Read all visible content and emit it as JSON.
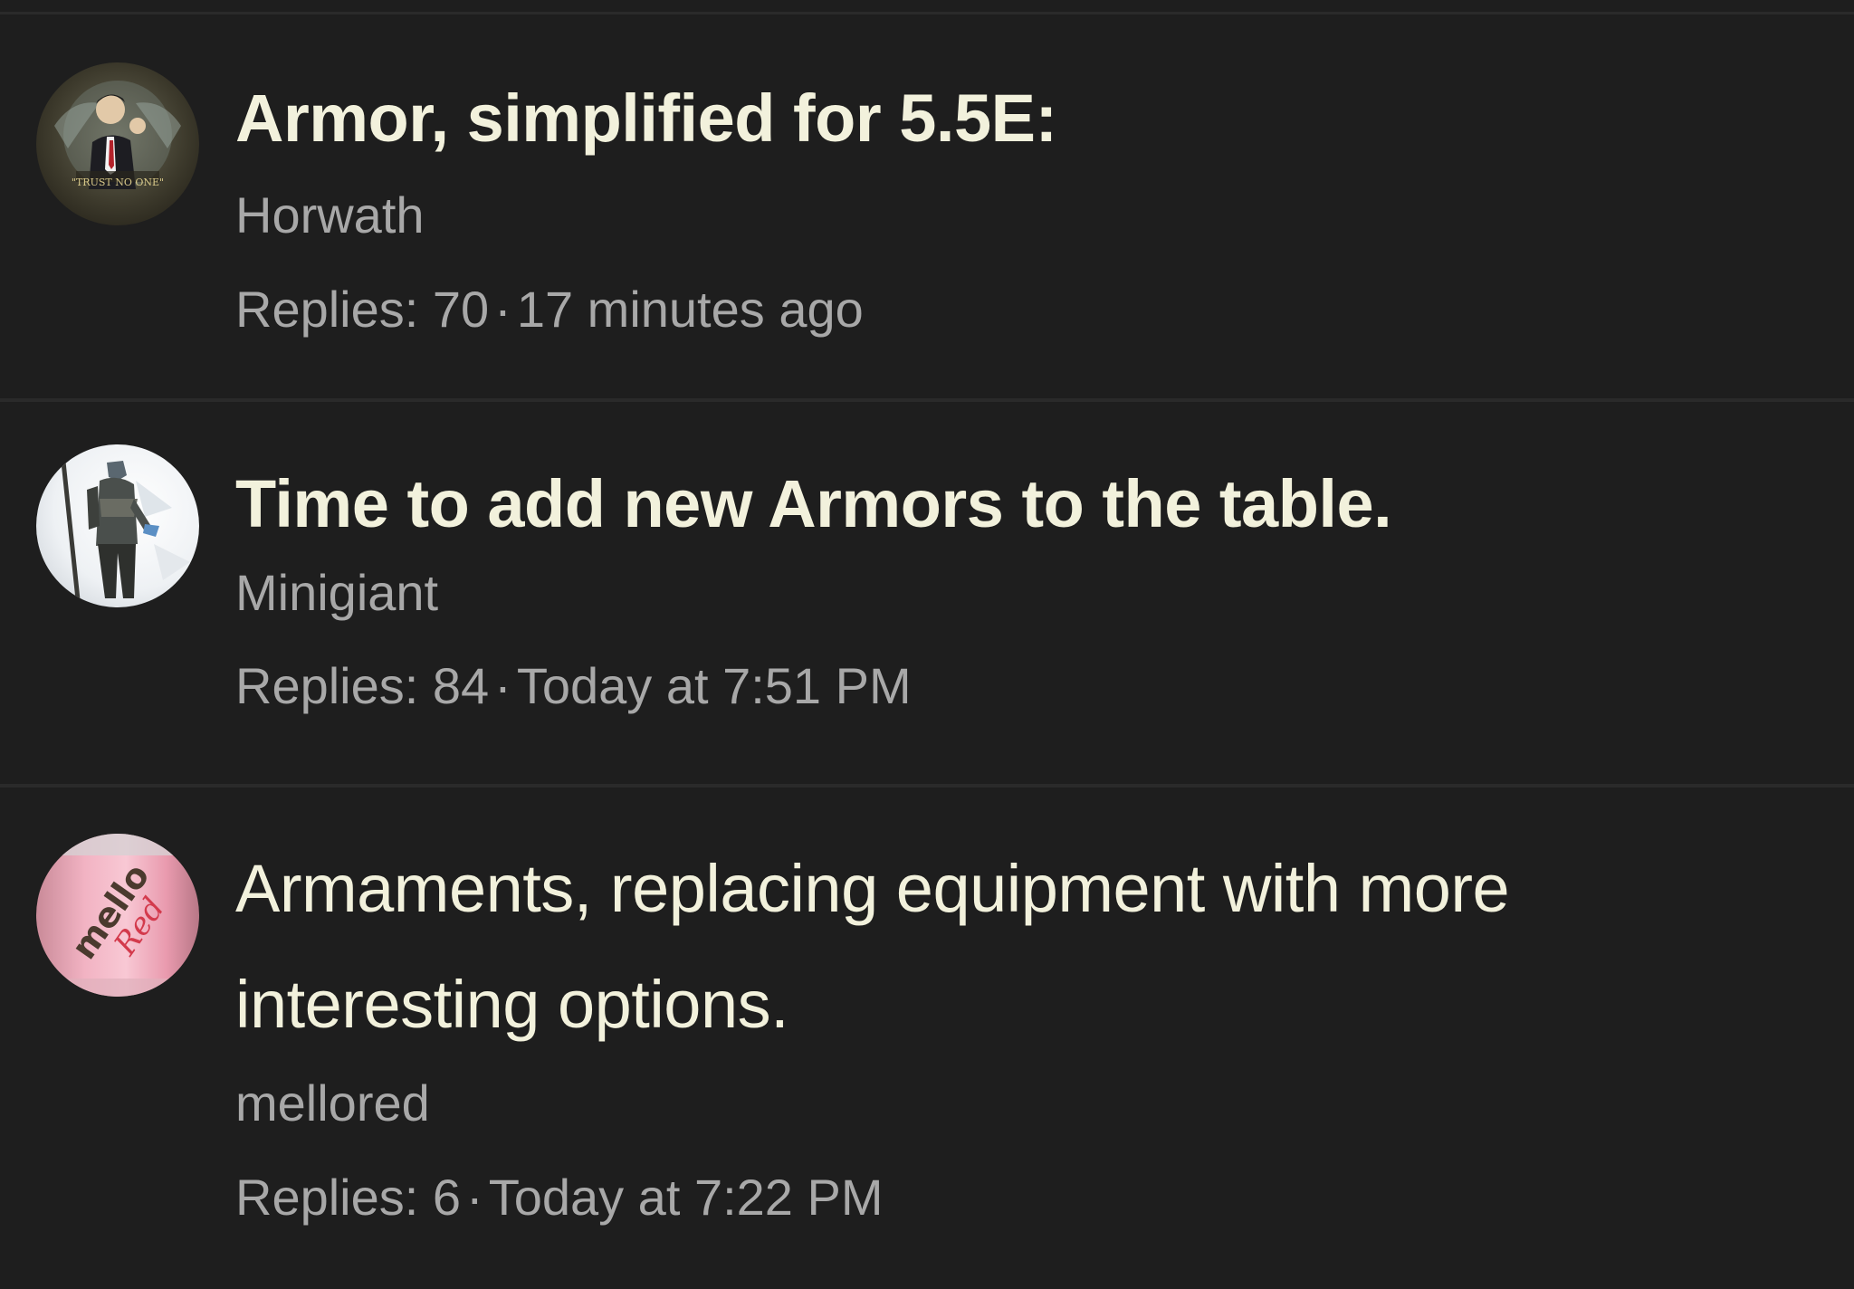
{
  "threads": [
    {
      "title": "Armor, simplified for 5.5E:",
      "author": "Horwath",
      "replies_label": "Replies: 70",
      "separator": "·",
      "time": "17 minutes ago",
      "avatar_text": "\"TRUST NO ONE\""
    },
    {
      "title": "Time to add new Armors to the table.",
      "author": "Minigiant",
      "replies_label": "Replies: 84",
      "separator": "·",
      "time": "Today at 7:51 PM"
    },
    {
      "title": "Armaments, replacing equipment with more interesting options.",
      "author": "mellored",
      "replies_label": "Replies: 6",
      "separator": "·",
      "time": "Today at 7:22 PM",
      "avatar_text_1": "mello",
      "avatar_text_2": "Red"
    }
  ],
  "colors": {
    "background": "#1e1e1e",
    "divider": "#2a2a2a",
    "title": "#f2f1dc",
    "secondary_text": "#a8a8a8"
  }
}
